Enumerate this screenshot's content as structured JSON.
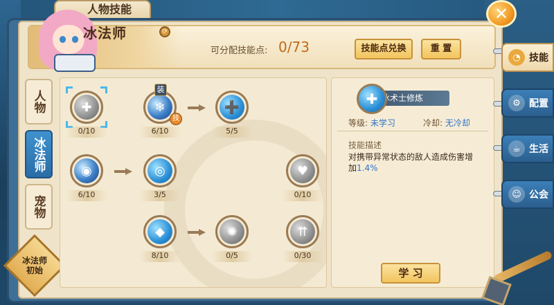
{
  "window": {
    "title": "人物技能",
    "close_label": "✕"
  },
  "header": {
    "class_name": "冰法师",
    "points_label": "可分配技能点:",
    "points_value": "0/73",
    "exchange_button": "技能点兑换",
    "reset_button": "重 置"
  },
  "left_tabs": [
    {
      "label": "人物",
      "active": false
    },
    {
      "label": "冰法师",
      "active": true
    },
    {
      "label": "宠物",
      "active": false
    }
  ],
  "class_badge": {
    "line1": "冰法师",
    "line2": "初始"
  },
  "skill_tree": {
    "nodes": [
      {
        "id": "n1",
        "icon": "shield-heal-icon",
        "count": "0/10",
        "selected": true
      },
      {
        "id": "n2",
        "icon": "ice-crystal-icon",
        "count": "6/10",
        "equip_label": "装",
        "tag_label": "技"
      },
      {
        "id": "n3",
        "icon": "ice-swirl-plus-icon",
        "count": "5/5"
      },
      {
        "id": "n4",
        "icon": "vortex-orb-icon",
        "count": "6/10"
      },
      {
        "id": "n5",
        "icon": "team-ring-icon",
        "count": "3/5"
      },
      {
        "id": "n6",
        "icon": "heart-plus-icon",
        "count": "0/10"
      },
      {
        "id": "n7",
        "icon": "diamond-shield-icon",
        "count": "8/10"
      },
      {
        "id": "n8",
        "icon": "swirl-gear-icon",
        "count": "0/5"
      },
      {
        "id": "n9",
        "icon": "triple-arrow-up-icon",
        "count": "0/30"
      }
    ]
  },
  "detail": {
    "skill_name": "冰术士修炼",
    "level_label": "等级:",
    "level_value": "未学习",
    "cooldown_label": "冷却:",
    "cooldown_value": "无冷却",
    "desc_title": "技能描述",
    "desc_text_1": "对携带异常状态的敌人造成伤害增加",
    "desc_value": "1.4%",
    "learn_button": "学 习"
  },
  "right_tabs": [
    {
      "label": "技能",
      "icon": "skill-swirl-icon",
      "active": true
    },
    {
      "label": "配置",
      "icon": "gear-icon",
      "active": false
    },
    {
      "label": "生活",
      "icon": "cup-icon",
      "active": false
    },
    {
      "label": "公会",
      "icon": "guild-people-icon",
      "active": false
    }
  ],
  "colors": {
    "accent_blue": "#2f73c8",
    "orange_value": "#c06a1a",
    "button_gold": "#f2c45e",
    "active_tab_blue": "#2a6ca6"
  }
}
